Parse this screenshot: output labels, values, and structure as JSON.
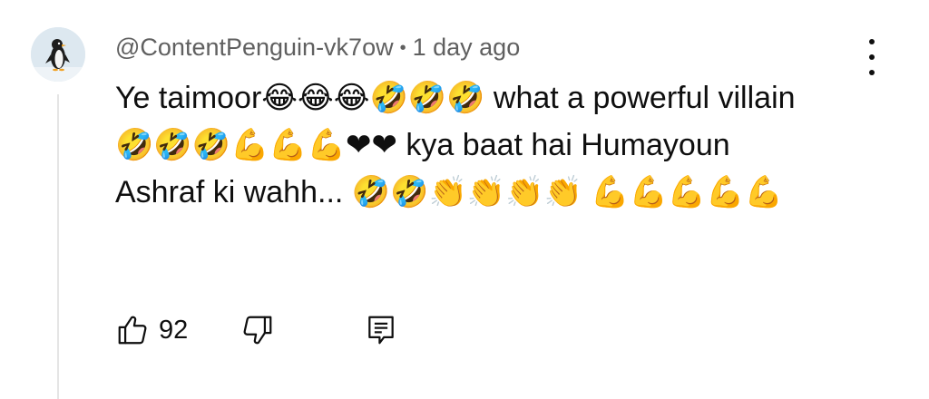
{
  "comment": {
    "author": "@ContentPenguin-vk7ow",
    "separator": "•",
    "time": "1 day ago",
    "text": "Ye taimoor😂😂😂🤣🤣🤣 what a powerful villain 🤣🤣🤣💪💪💪❤❤ kya baat hai Humayoun Ashraf ki wahh... 🤣🤣👏👏👏👏 💪💪💪💪💪",
    "like_count": "92"
  },
  "icons": {
    "avatar": "penguin-avatar",
    "menu": "kebab-menu-icon",
    "like": "thumbs-up-icon",
    "dislike": "thumbs-down-icon",
    "reply": "reply-comment-icon"
  },
  "colors": {
    "text": "#0f0f0f",
    "meta": "#606060",
    "thread_line": "#e5e5e5"
  }
}
